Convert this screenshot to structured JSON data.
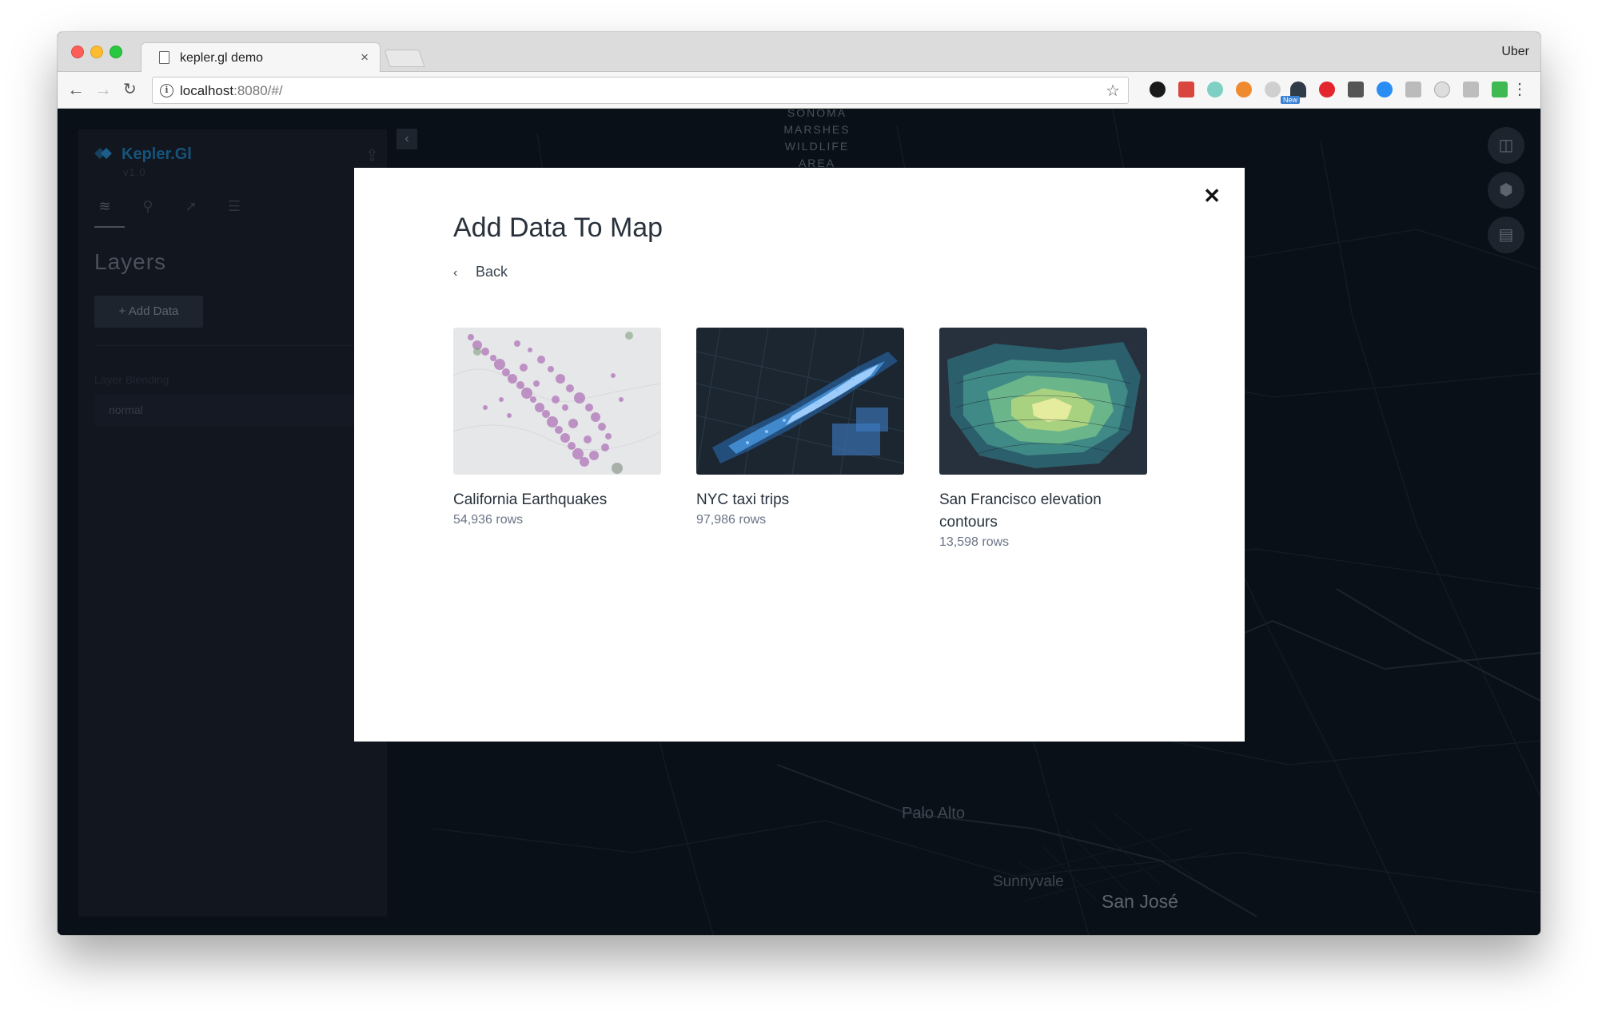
{
  "browser": {
    "tab_title": "kepler.gl demo",
    "tab_close": "×",
    "profile": "Uber",
    "url_host": "localhost",
    "url_rest": ":8080/#/",
    "info_icon": "i",
    "ext_new_badge": "New"
  },
  "sidebar": {
    "brand": "Kepler.Gl",
    "version": "v1.0",
    "title": "Layers",
    "add_data_label": "Add Data",
    "blending_label": "Layer Blending",
    "blending_value": "normal"
  },
  "map": {
    "labels": {
      "marshes_line1": "SONOMA",
      "marshes_line2": "MARSHES",
      "marshes_line3": "WILDLIFE",
      "marshes_line4": "AREA",
      "palo_alto": "Palo Alto",
      "sunnyvale": "Sunnyvale",
      "san_jose": "San José"
    }
  },
  "modal": {
    "title": "Add Data To Map",
    "back_label": "Back",
    "datasets": [
      {
        "name": "California Earthquakes",
        "rows": "54,936 rows"
      },
      {
        "name": "NYC taxi trips",
        "rows": "97,986 rows"
      },
      {
        "name": "San Francisco elevation contours",
        "rows": "13,598 rows"
      }
    ]
  },
  "icons": {
    "back": "chevron-left-icon",
    "close": "close-icon",
    "add": "plus-icon",
    "share": "share-icon",
    "layers": "layers-icon",
    "filters": "filter-icon",
    "interactions": "cursor-icon",
    "map_settings": "sliders-icon",
    "split_map": "split-map-icon",
    "3d": "cube-icon",
    "legend": "legend-icon"
  },
  "colors": {
    "brand": "#1f7cb4",
    "modal_bg": "#ffffff",
    "map_bg": "#0d141d"
  }
}
